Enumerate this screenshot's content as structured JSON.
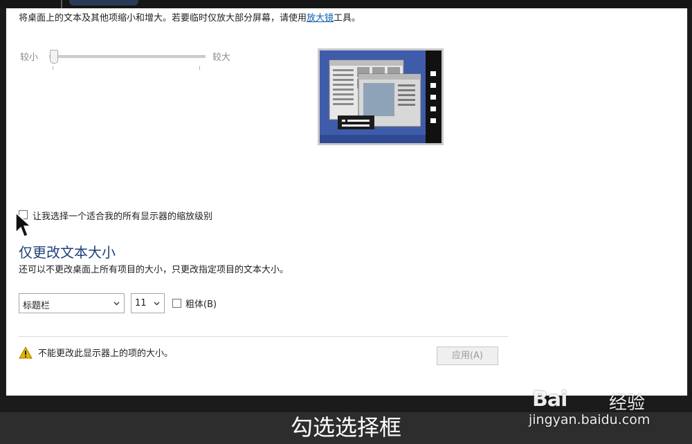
{
  "intro": {
    "text_before": "将桌面上的文本及其他项缩小和增大。若要临时仅放大部分屏幕，请使用",
    "link": "放大镜",
    "text_after": "工具。"
  },
  "slider": {
    "min_label": "较小",
    "max_label": "较大",
    "level": 0
  },
  "scaling_checkbox": {
    "label": "让我选择一个适合我的所有显示器的缩放级别",
    "checked": false
  },
  "text_size_section": {
    "heading": "仅更改文本大小",
    "description": "还可以不更改桌面上所有项目的大小，只更改指定项目的文本大小。",
    "item_select": "标题栏",
    "size_select": "11",
    "bold_label": "粗体(B)",
    "bold_checked": false
  },
  "warning": {
    "text": "不能更改此显示器上的项的大小。"
  },
  "apply_button": "应用(A)",
  "subtitle": "勾选选择框",
  "watermark": {
    "brand": "Bai",
    "brand_suffix": "经验",
    "url": "jingyan.baidu.com"
  },
  "colors": {
    "heading": "#1e3f7a",
    "link": "#0b5cad",
    "preview_bg": "#3f5cab",
    "warning": "#e8b400"
  }
}
